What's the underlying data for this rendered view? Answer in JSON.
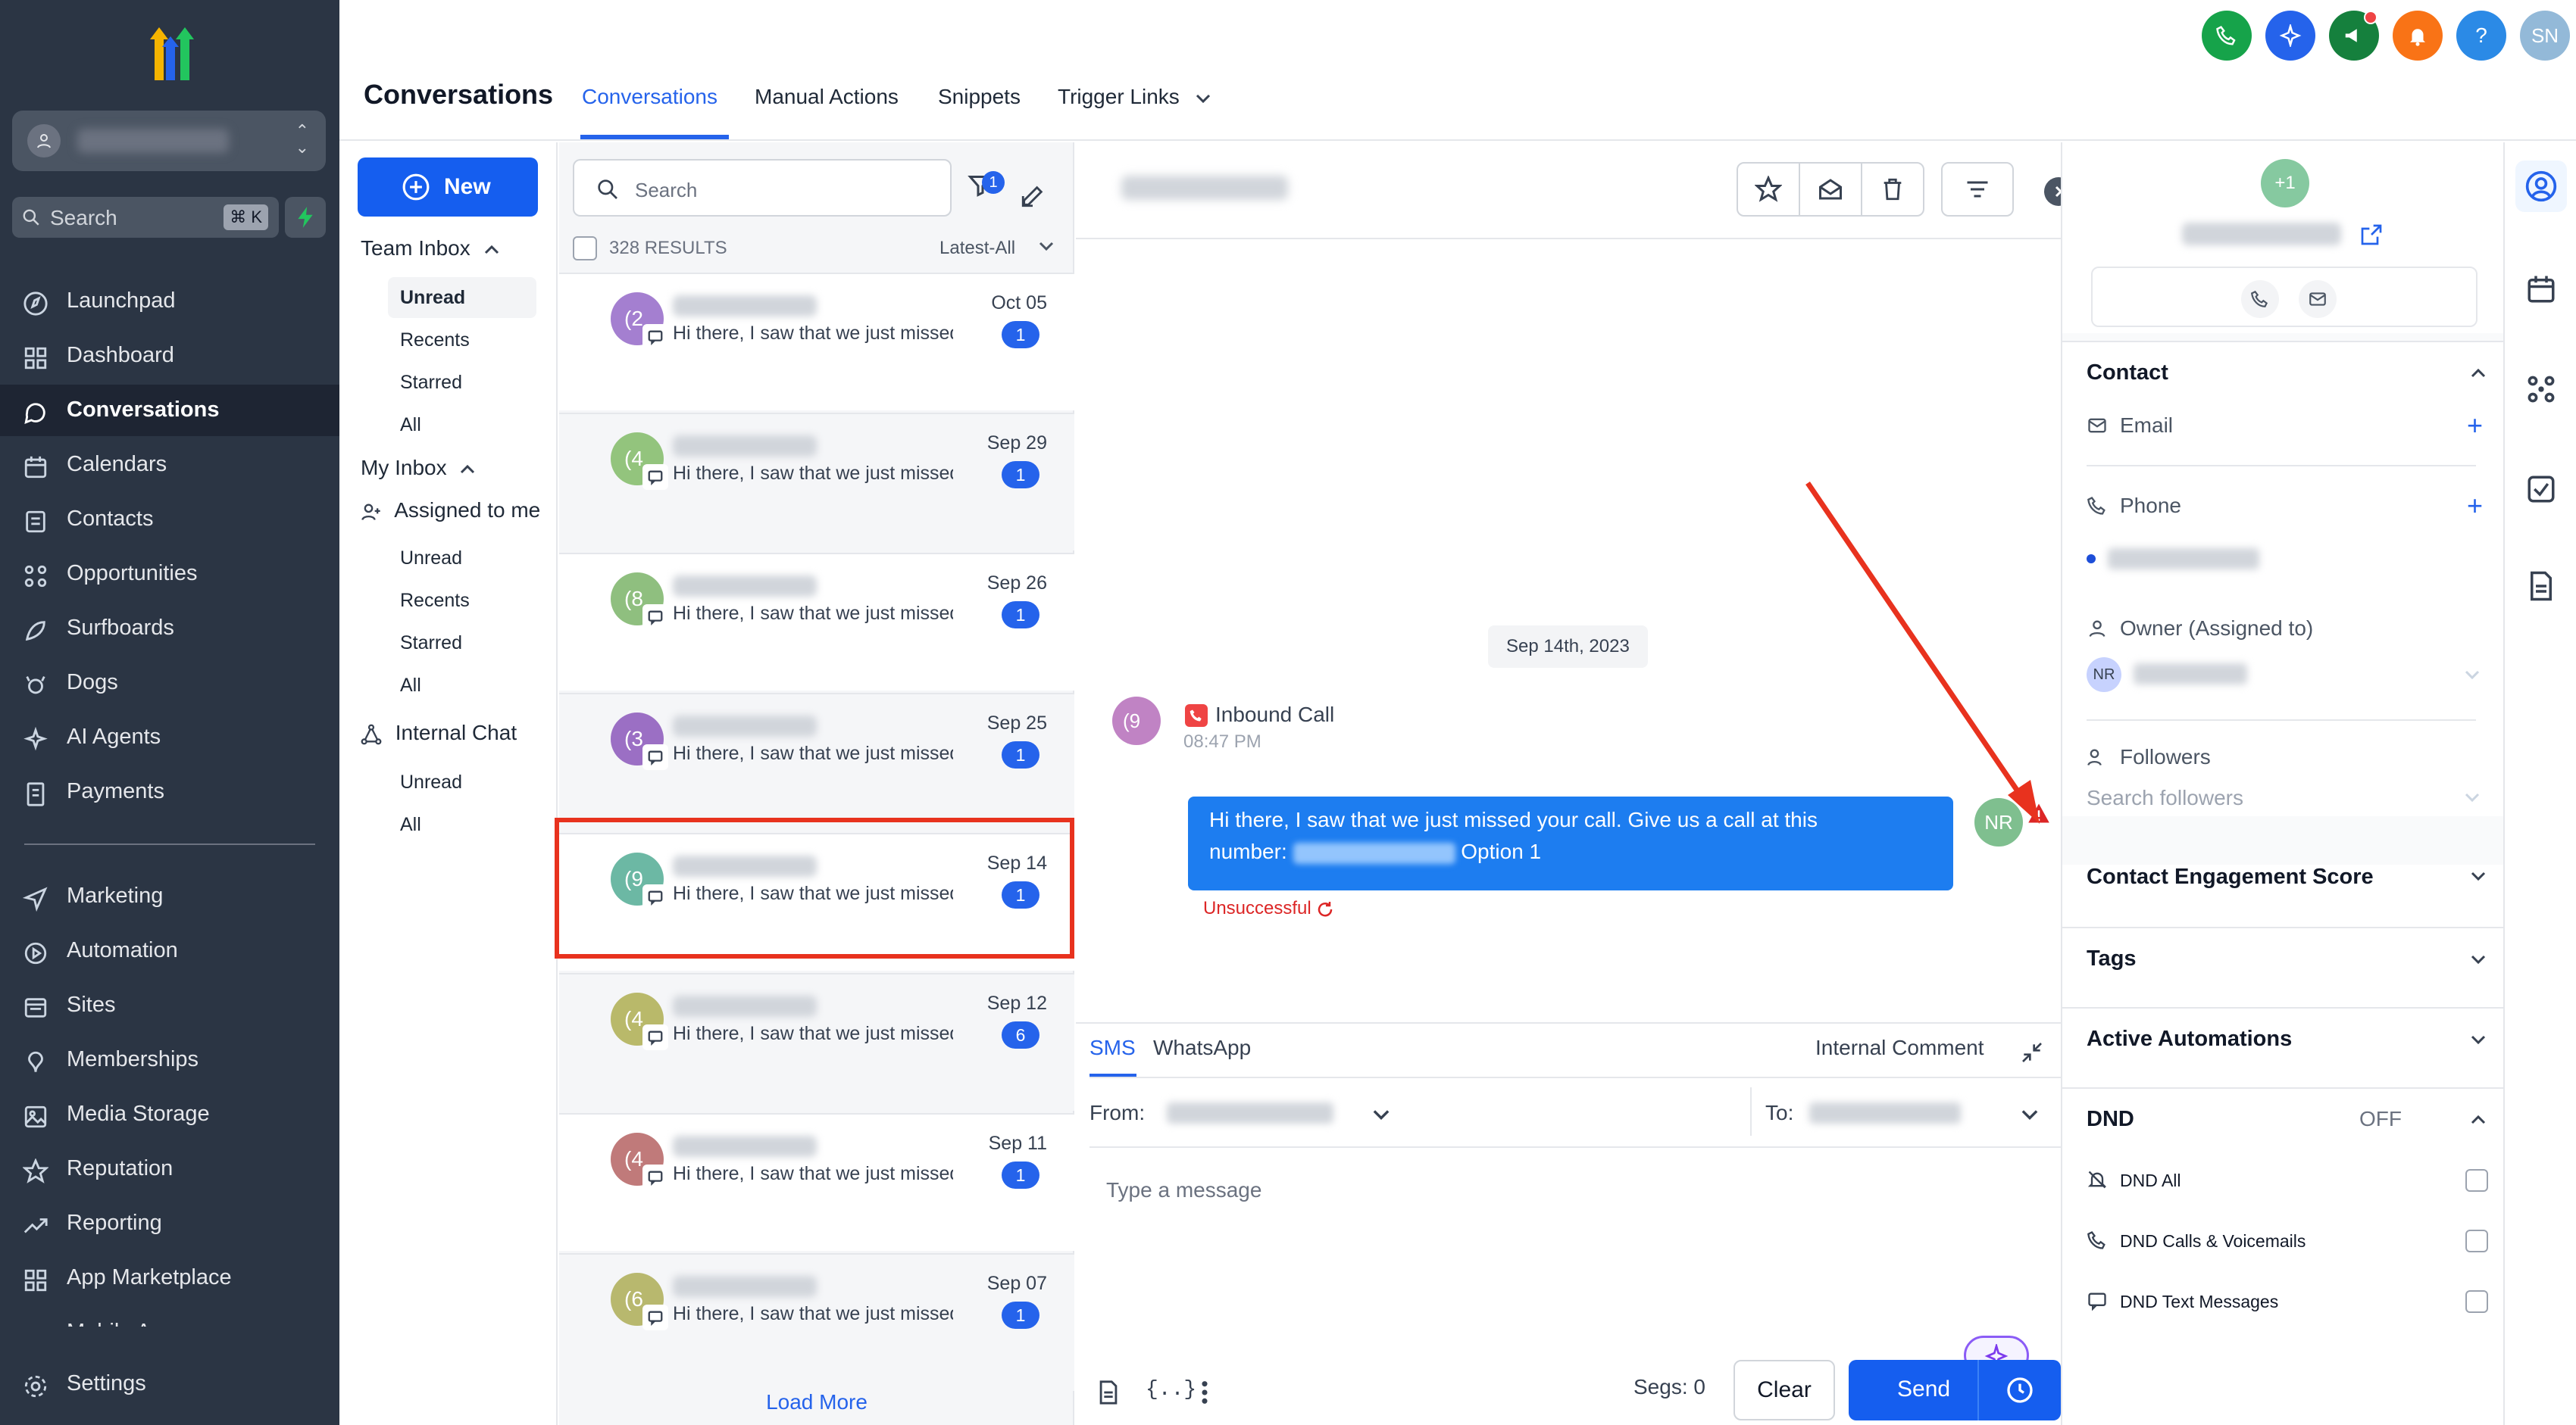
{
  "sidebar": {
    "search_placeholder": "Search",
    "search_shortcut": "⌘ K",
    "items": [
      {
        "label": "Launchpad",
        "icon": "launchpad-icon"
      },
      {
        "label": "Dashboard",
        "icon": "dashboard-icon"
      },
      {
        "label": "Conversations",
        "icon": "chat-icon",
        "active": true
      },
      {
        "label": "Calendars",
        "icon": "calendar-icon"
      },
      {
        "label": "Contacts",
        "icon": "contacts-icon"
      },
      {
        "label": "Opportunities",
        "icon": "opportunities-icon"
      },
      {
        "label": "Surfboards",
        "icon": "surfboard-icon"
      },
      {
        "label": "Dogs",
        "icon": "dog-icon"
      },
      {
        "label": "AI Agents",
        "icon": "ai-agents-icon"
      },
      {
        "label": "Payments",
        "icon": "payments-icon"
      },
      {
        "label": "Marketing",
        "icon": "marketing-icon"
      },
      {
        "label": "Automation",
        "icon": "automation-icon"
      },
      {
        "label": "Sites",
        "icon": "sites-icon"
      },
      {
        "label": "Memberships",
        "icon": "memberships-icon"
      },
      {
        "label": "Media Storage",
        "icon": "media-icon"
      },
      {
        "label": "Reputation",
        "icon": "star-icon"
      },
      {
        "label": "Reporting",
        "icon": "reporting-icon"
      },
      {
        "label": "App Marketplace",
        "icon": "marketplace-icon"
      },
      {
        "label": "Mobile App",
        "icon": "mobile-icon"
      },
      {
        "label": "Settings",
        "icon": "gear-icon"
      }
    ]
  },
  "header": {
    "title": "Conversations",
    "tabs": [
      "Conversations",
      "Manual Actions",
      "Snippets",
      "Trigger Links"
    ],
    "user_initials": "SN",
    "help": "?"
  },
  "inbox": {
    "new_label": "New",
    "team_inbox": "Team Inbox",
    "team_items": [
      "Unread",
      "Recents",
      "Starred",
      "All"
    ],
    "my_inbox": "My Inbox",
    "assigned": "Assigned to me",
    "my_items": [
      "Unread",
      "Recents",
      "Starred",
      "All"
    ],
    "internal_chat": "Internal Chat",
    "chat_items": [
      "Unread",
      "All"
    ]
  },
  "convlist": {
    "search_placeholder": "Search",
    "filter_count": "1",
    "results": "328 RESULTS",
    "sort": "Latest-All",
    "load_more": "Load More",
    "items": [
      {
        "avatar": "(2",
        "preview": "Hi there, I saw that we just missed your call",
        "date": "Oct 05",
        "count": "1",
        "color": "#a47fd0"
      },
      {
        "avatar": "(4",
        "preview": "Hi there, I saw that we just missed your call",
        "date": "Sep 29",
        "count": "1",
        "color": "#93c47d"
      },
      {
        "avatar": "(8",
        "preview": "Hi there, I saw that we just missed your call",
        "date": "Sep 26",
        "count": "1",
        "color": "#8fbf7f"
      },
      {
        "avatar": "(3",
        "preview": "Hi there, I saw that we just missed your call",
        "date": "Sep 25",
        "count": "1",
        "color": "#9b6fc4"
      },
      {
        "avatar": "(9",
        "preview": "Hi there, I saw that we just missed your call",
        "date": "Sep 14",
        "count": "1",
        "color": "#6cb8a4"
      },
      {
        "avatar": "(4",
        "preview": "Hi there, I saw that we just missed your call",
        "date": "Sep 12",
        "count": "6",
        "color": "#b9b96a"
      },
      {
        "avatar": "(4",
        "preview": "Hi there, I saw that we just missed your call",
        "date": "Sep 11",
        "count": "1",
        "color": "#c07a7a"
      },
      {
        "avatar": "(6",
        "preview": "Hi there, I saw that we just missed your call",
        "date": "Sep 07",
        "count": "1",
        "color": "#b8b86e"
      }
    ]
  },
  "chat": {
    "date_divider": "Sep 14th, 2023",
    "contact_avatar": "(9",
    "call_title": "Inbound Call",
    "call_time": "08:47 PM",
    "message_line1": "Hi there, I saw that we just missed your call. Give us a call at this",
    "message_number_label": "number:",
    "message_option": "Option 1",
    "sender_initials": "NR",
    "status": "Unsuccessful",
    "composer": {
      "tab_sms": "SMS",
      "tab_whatsapp": "WhatsApp",
      "internal_comment": "Internal Comment",
      "from": "From:",
      "to": "To:",
      "placeholder": "Type a message",
      "segs": "Segs: 0",
      "clear": "Clear",
      "send": "Send"
    }
  },
  "contact": {
    "avatar": "+1",
    "section_contact": "Contact",
    "email": "Email",
    "phone": "Phone",
    "owner": "Owner (Assigned to)",
    "owner_initials": "NR",
    "followers": "Followers",
    "search_followers": "Search followers",
    "engagement": "Contact Engagement Score",
    "tags": "Tags",
    "automations": "Active Automations",
    "dnd": "DND",
    "dnd_state": "OFF",
    "dnd_all": "DND All",
    "dnd_calls": "DND Calls & Voicemails",
    "dnd_text": "DND Text Messages"
  },
  "colors": {
    "sidebar_bg": "#2b3544",
    "primary": "#155eef",
    "annotation_red": "#e8321e"
  }
}
